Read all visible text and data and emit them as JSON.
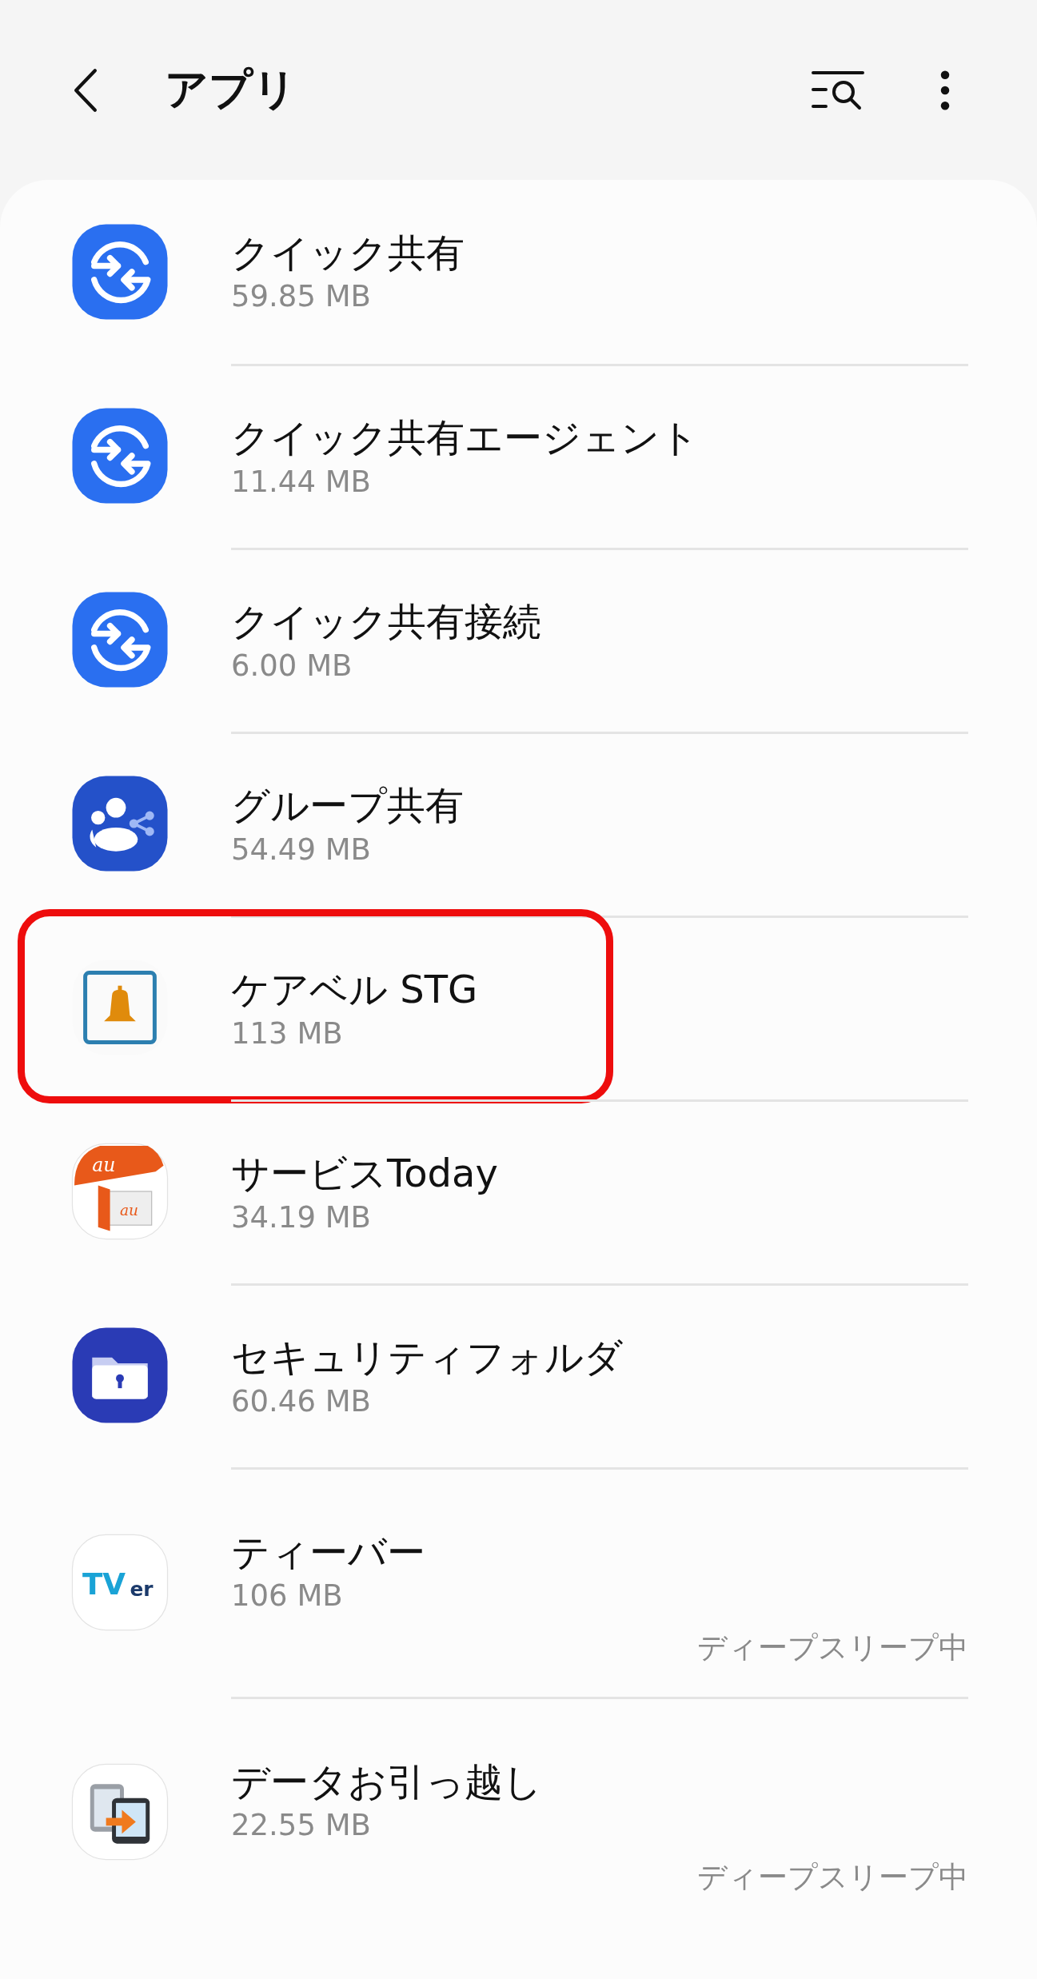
{
  "header": {
    "title": "アプリ"
  },
  "apps": [
    {
      "name": "クイック共有",
      "size": "59.85 MB",
      "kind": "share",
      "highlighted": false
    },
    {
      "name": "クイック共有エージェント",
      "size": "11.44 MB",
      "kind": "share",
      "highlighted": false
    },
    {
      "name": "クイック共有接続",
      "size": "6.00 MB",
      "kind": "share",
      "highlighted": false
    },
    {
      "name": "グループ共有",
      "size": "54.49 MB",
      "kind": "group",
      "highlighted": false
    },
    {
      "name": "ケアベル STG",
      "size": "113 MB",
      "kind": "bell",
      "highlighted": true
    },
    {
      "name": "サービスToday",
      "size": "34.19 MB",
      "kind": "door",
      "icon_text": [
        "au",
        "au"
      ],
      "highlighted": false
    },
    {
      "name": "セキュリティフォルダ",
      "size": "60.46 MB",
      "kind": "folder",
      "highlighted": false
    },
    {
      "name": "ティーバー",
      "size": "106 MB",
      "kind": "tv",
      "icon_text": [
        "TV",
        "er"
      ],
      "status": "ディープスリープ中",
      "highlighted": false
    },
    {
      "name": "データお引っ越し",
      "size": "22.55 MB",
      "kind": "transfer",
      "status": "ディープスリープ中",
      "highlighted": false
    }
  ]
}
